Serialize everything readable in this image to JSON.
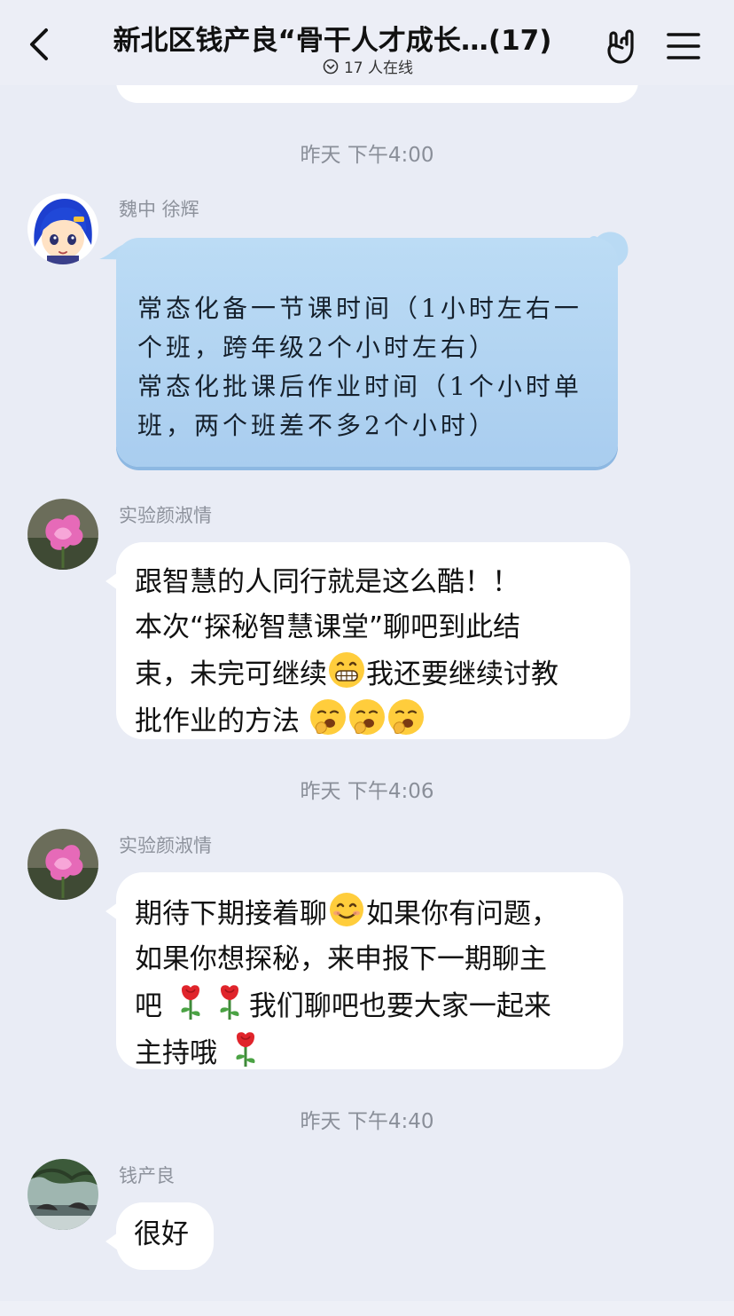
{
  "header": {
    "title": "新北区钱产良“骨干人才成长…(17)",
    "online": "17 人在线"
  },
  "messages": [
    {
      "timestamp": "昨天 下午4:00",
      "sender": "魏中 徐辉",
      "lines": [
        "常态化备一节课时间（1小时左右一",
        "个班，跨年级2个小时左右）",
        "常态化批课后作业时间（1个小时单",
        "班，两个班差不多2个小时）"
      ]
    },
    {
      "sender": "实验颜淑情",
      "lines": [
        "跟智慧的人同行就是这么酷！！",
        "本次“探秘智慧课堂”聊吧到此结",
        "束，未完可继续",
        "我还要继续讨教",
        "批作业的方法"
      ]
    },
    {
      "timestamp": "昨天 下午4:06",
      "sender": "实验颜淑情",
      "lines": [
        "期待下期接着聊",
        "如果你有问题，",
        "如果你想探秘，来申报下一期聊主",
        "吧",
        "我们聊吧也要大家一起来",
        "主持哦"
      ]
    },
    {
      "timestamp": "昨天 下午4:40",
      "sender": "钱产良",
      "lines": [
        "很好"
      ]
    }
  ],
  "icons": {
    "back": "chevron-left-icon",
    "hand": "rock-hand-icon",
    "menu": "hamburger-menu-icon",
    "grin_emoji": "grinning-face-emoji",
    "yawn_emoji": "yawning-face-emoji",
    "smile_emoji": "smiling-face-emoji",
    "rose_emoji": "rose-emoji"
  },
  "colors": {
    "background": "#e9ecf5",
    "bubble": "#ffffff",
    "themed_bubble": "#b4d6f3",
    "timestamp_text": "#8a8f99"
  }
}
